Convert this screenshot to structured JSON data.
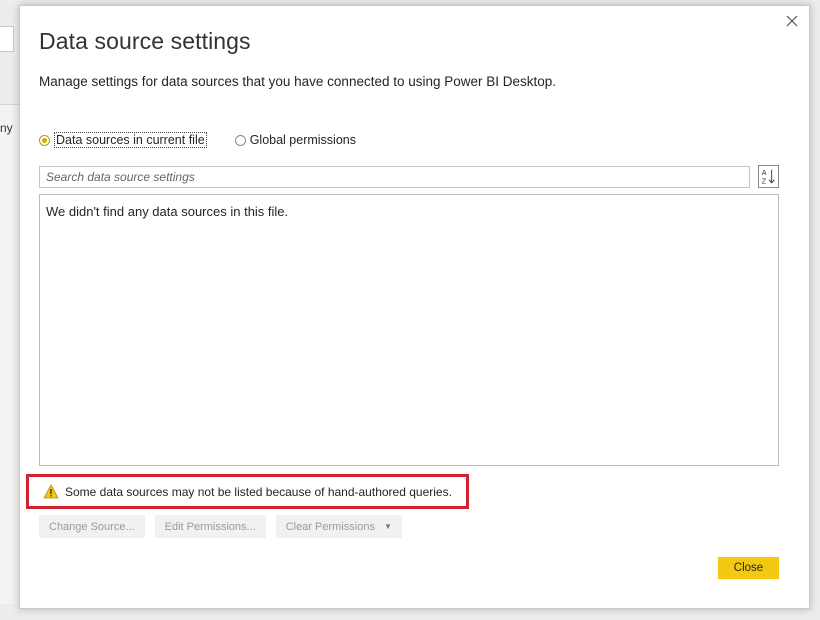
{
  "background": {
    "partial_text": "ny"
  },
  "dialog": {
    "title": "Data source settings",
    "subtitle": "Manage settings for data sources that you have connected to using Power BI Desktop.",
    "close_icon": "close-icon",
    "scope": {
      "options": [
        {
          "label": "Data sources in current file",
          "selected": true
        },
        {
          "label": "Global permissions",
          "selected": false
        }
      ]
    },
    "search": {
      "placeholder": "Search data source settings",
      "value": ""
    },
    "sort_icon": "sort-az-icon",
    "list": {
      "empty_message": "We didn't find any data sources in this file."
    },
    "warning": {
      "icon": "warning-icon",
      "text": "Some data sources may not be listed because of hand-authored queries.",
      "highlight_color": "#d0232f"
    },
    "actions": {
      "change_source": "Change Source...",
      "edit_permissions": "Edit Permissions...",
      "clear_permissions": "Clear Permissions"
    },
    "close_button": "Close",
    "accent_color": "#f2c811"
  }
}
